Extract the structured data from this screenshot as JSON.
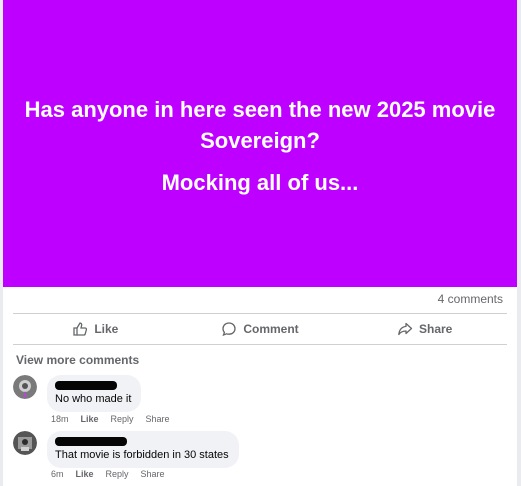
{
  "post": {
    "line1": "Has anyone in here seen the new 2025 movie Sovereign?",
    "line2": "Mocking all of us...",
    "background_color": "#bd00ff"
  },
  "stats": {
    "comments": "4 comments"
  },
  "actions": {
    "like": "Like",
    "comment": "Comment",
    "share": "Share"
  },
  "view_more": "View more comments",
  "comments": [
    {
      "text": "No who made it",
      "time": "18m",
      "like": "Like",
      "reply": "Reply",
      "share": "Share"
    },
    {
      "text": "That movie is forbidden in 30 states",
      "time": "6m",
      "like": "Like",
      "reply": "Reply",
      "share": "Share"
    }
  ]
}
